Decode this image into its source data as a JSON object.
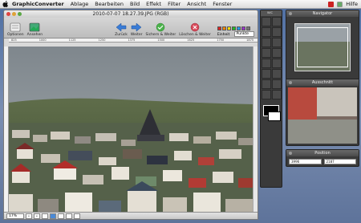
{
  "menubar": {
    "app": "GraphicConverter",
    "items": [
      "Ablage",
      "Bearbeiten",
      "Bild",
      "Effekt",
      "Filter",
      "Ansicht",
      "Fenster"
    ],
    "help": "Hilfe"
  },
  "window": {
    "title": "2010-07-07 18.27.39.JPG (RGB)",
    "toolbar": {
      "options": "Optionen",
      "view": "Ansehen",
      "back": "Zurück",
      "forward": "Weiter",
      "save_next": "Sichern & Weiter",
      "delete_next": "Löschen & Weiter",
      "units": "Einheit",
      "units_value": "Punkte"
    },
    "ruler_marks": [
      "825",
      "1000",
      "1125",
      "1250",
      "1375",
      "1500",
      "1625",
      "1750",
      "1875"
    ],
    "status": {
      "zoom": "17%"
    }
  },
  "tools_palette": {
    "title": "WIC"
  },
  "navigator": {
    "title": "Navigator"
  },
  "ausschnitt": {
    "title": "Ausschnitt"
  },
  "position": {
    "title": "Position",
    "x": "3996",
    "y": "2187"
  },
  "color_swatches": [
    "#d22",
    "#f80",
    "#fd0",
    "#2b2",
    "#29e",
    "#93c",
    "#777"
  ]
}
